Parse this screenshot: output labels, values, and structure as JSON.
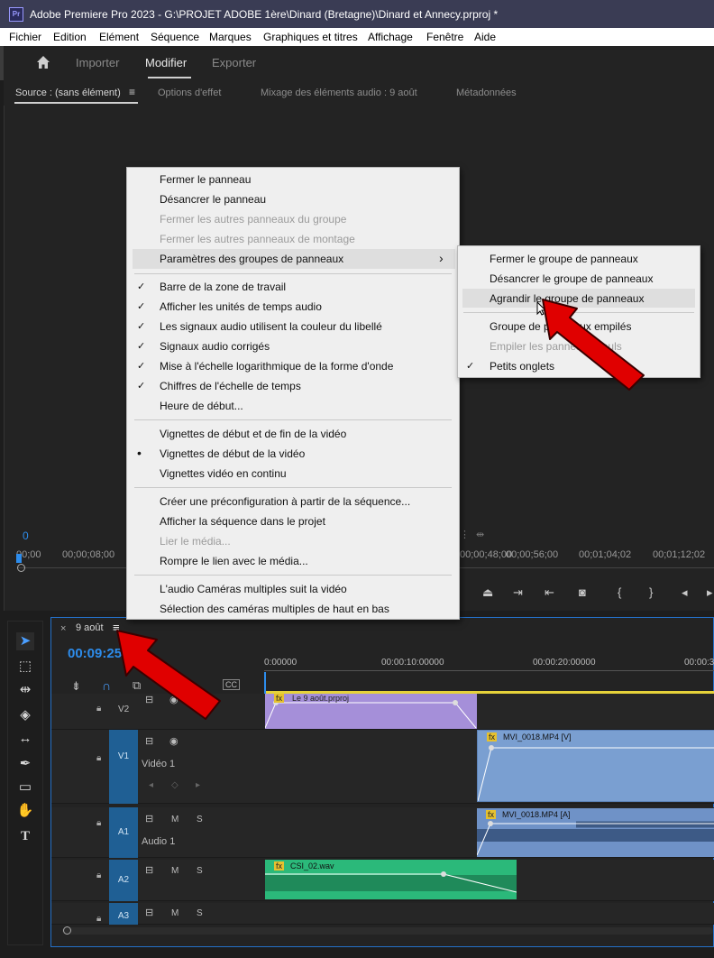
{
  "titlebar": {
    "app_icon": "Pr",
    "title": "Adobe Premiere Pro 2023 - G:\\PROJET ADOBE 1ère\\Dinard (Bretagne)\\Dinard et Annecy.prproj *"
  },
  "menubar": {
    "items": [
      "Fichier",
      "Edition",
      "Elément",
      "Séquence",
      "Marques",
      "Graphiques et titres",
      "Affichage",
      "Fenêtre",
      "Aide"
    ]
  },
  "workspace": {
    "home_icon": "home-icon",
    "tabs": [
      "Importer",
      "Modifier",
      "Exporter"
    ],
    "active": "Modifier"
  },
  "panel_tabs": {
    "source": "Source : (sans élément)",
    "effects": "Options d'effet",
    "audio_mixer": "Mixage des éléments audio : 9 août",
    "metadata": "Métadonnées"
  },
  "source_ruler": {
    "playhead": "0",
    "ticks": [
      "00;00",
      "00;00;08;00",
      "00;00;48;00",
      "00;00;56;00",
      "00;01;04;02",
      "00;01;12;02"
    ]
  },
  "context_menu": {
    "items": [
      {
        "label": "Fermer le panneau",
        "check": "",
        "disabled": false
      },
      {
        "label": "Désancrer le panneau",
        "check": "",
        "disabled": false
      },
      {
        "label": "Fermer les autres panneaux du groupe",
        "check": "",
        "disabled": true
      },
      {
        "label": "Fermer les autres panneaux de montage",
        "check": "",
        "disabled": true
      },
      {
        "label": "Paramètres des groupes de panneaux",
        "check": "",
        "disabled": false,
        "submenu_arrow": "›"
      },
      {
        "label": "Barre de la zone de travail",
        "check": "✓",
        "disabled": false
      },
      {
        "label": "Afficher les unités de temps audio",
        "check": "✓",
        "disabled": false
      },
      {
        "label": "Les signaux audio utilisent la couleur du libellé",
        "check": "✓",
        "disabled": false
      },
      {
        "label": "Signaux audio corrigés",
        "check": "✓",
        "disabled": false
      },
      {
        "label": "Mise à l'échelle logarithmique de la forme d'onde",
        "check": "✓",
        "disabled": false
      },
      {
        "label": "Chiffres de l'échelle de temps",
        "check": "✓",
        "disabled": false
      },
      {
        "label": "Heure de début...",
        "check": "",
        "disabled": false
      },
      {
        "label": "Vignettes de début et de fin de la vidéo",
        "check": "",
        "disabled": false
      },
      {
        "label": "Vignettes de début de la vidéo",
        "check": "•",
        "disabled": false
      },
      {
        "label": "Vignettes vidéo en continu",
        "check": "",
        "disabled": false
      },
      {
        "label": "Créer une préconfiguration à partir de la séquence...",
        "check": "",
        "disabled": false
      },
      {
        "label": "Afficher la séquence dans le projet",
        "check": "",
        "disabled": false
      },
      {
        "label": "Lier le média...",
        "check": "",
        "disabled": true
      },
      {
        "label": "Rompre le lien avec le média...",
        "check": "",
        "disabled": false
      },
      {
        "label": "L'audio Caméras multiples suit la vidéo",
        "check": "",
        "disabled": false
      },
      {
        "label": "Sélection des caméras multiples de haut en bas",
        "check": "",
        "disabled": false
      }
    ]
  },
  "submenu": {
    "items": [
      {
        "label": "Fermer le groupe de panneaux",
        "check": "",
        "disabled": false
      },
      {
        "label": "Désancrer le groupe de panneaux",
        "check": "",
        "disabled": false
      },
      {
        "label": "Agrandir le groupe de panneaux",
        "check": "",
        "disabled": false
      },
      {
        "label": "Groupe de panneaux empilés",
        "check": "",
        "disabled": false
      },
      {
        "label": "Empiler les panneaux seuls",
        "check": "",
        "disabled": true
      },
      {
        "label": "Petits onglets",
        "check": "✓",
        "disabled": false
      }
    ]
  },
  "timeline": {
    "close": "×",
    "sequence_tab": "9 août",
    "timecode": "00:09:25:0",
    "ruler": [
      "0:00000",
      "00:00:10:00000",
      "00:00:20:00000",
      "00:00:3"
    ],
    "tracks": {
      "v2": "V2",
      "v1": "V1",
      "v1_name": "Vidéo 1",
      "a1": "A1",
      "a1_name": "Audio 1",
      "a2": "A2",
      "a3": "A3"
    },
    "track_ms": {
      "m": "M",
      "s": "S"
    },
    "clips": {
      "v2": "Le 9 août.prproj",
      "v1": "MVI_0018.MP4 [V]",
      "a1": "MVI_0018.MP4 [A]",
      "a2": "CSI_02.wav",
      "fx": "fx"
    },
    "cc": "CC"
  },
  "colors": {
    "accent": "#2d8ceb",
    "arrow": "#e00000",
    "video_clip": "#7a9fd1",
    "audio_green": "#2bb97a",
    "nested_clip": "#a58fd9"
  }
}
